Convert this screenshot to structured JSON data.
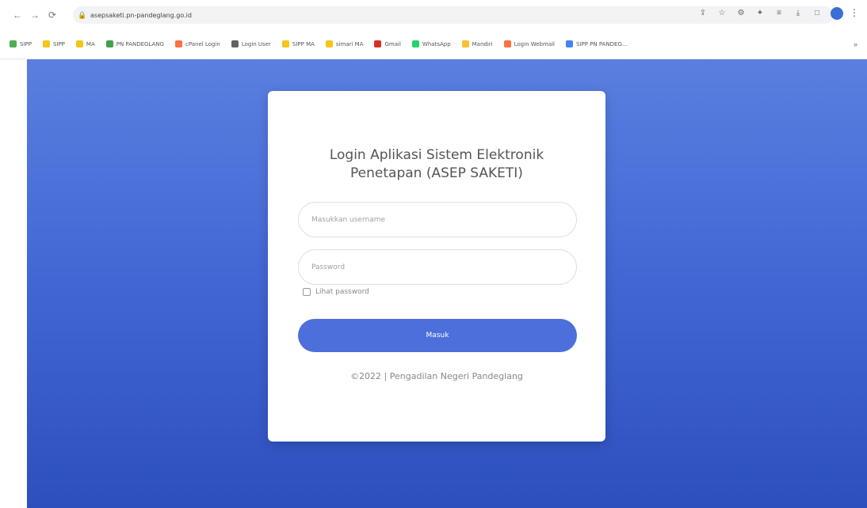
{
  "browser": {
    "url": "asepsaketi.pn-pandeglang.go.id",
    "bookmarks": [
      {
        "label": "SIPP",
        "color": "#4caf50"
      },
      {
        "label": "SIPP",
        "color": "#f5c518"
      },
      {
        "label": "MA",
        "color": "#f5c518"
      },
      {
        "label": "PN PANDEGLANG",
        "color": "#43a047"
      },
      {
        "label": "cPanel Login",
        "color": "#ff7043"
      },
      {
        "label": "Login User",
        "color": "#5f6368"
      },
      {
        "label": "SIPP MA",
        "color": "#f5c518"
      },
      {
        "label": "simari MA",
        "color": "#f5c518"
      },
      {
        "label": "Gmail",
        "color": "#d93025"
      },
      {
        "label": "WhatsApp",
        "color": "#25d366"
      },
      {
        "label": "Mandiri",
        "color": "#fbc02d"
      },
      {
        "label": "Login Webmail",
        "color": "#ff7043"
      },
      {
        "label": "SIPP PN PANDEG...",
        "color": "#4285f4"
      }
    ]
  },
  "login": {
    "title_line1": "Login Aplikasi Sistem Elektronik",
    "title_line2": "Penetapan (ASEP SAKETI)",
    "username_placeholder": "Masukkan username",
    "password_placeholder": "Password",
    "show_password_label": "Lihat password",
    "submit_label": "Masuk",
    "footer": "©2022 | Pengadilan Negeri Pandeglang"
  },
  "colors": {
    "bg_top": "#5a7fe0",
    "bg_bottom": "#2d4fbe",
    "button": "#4d6fdc"
  }
}
